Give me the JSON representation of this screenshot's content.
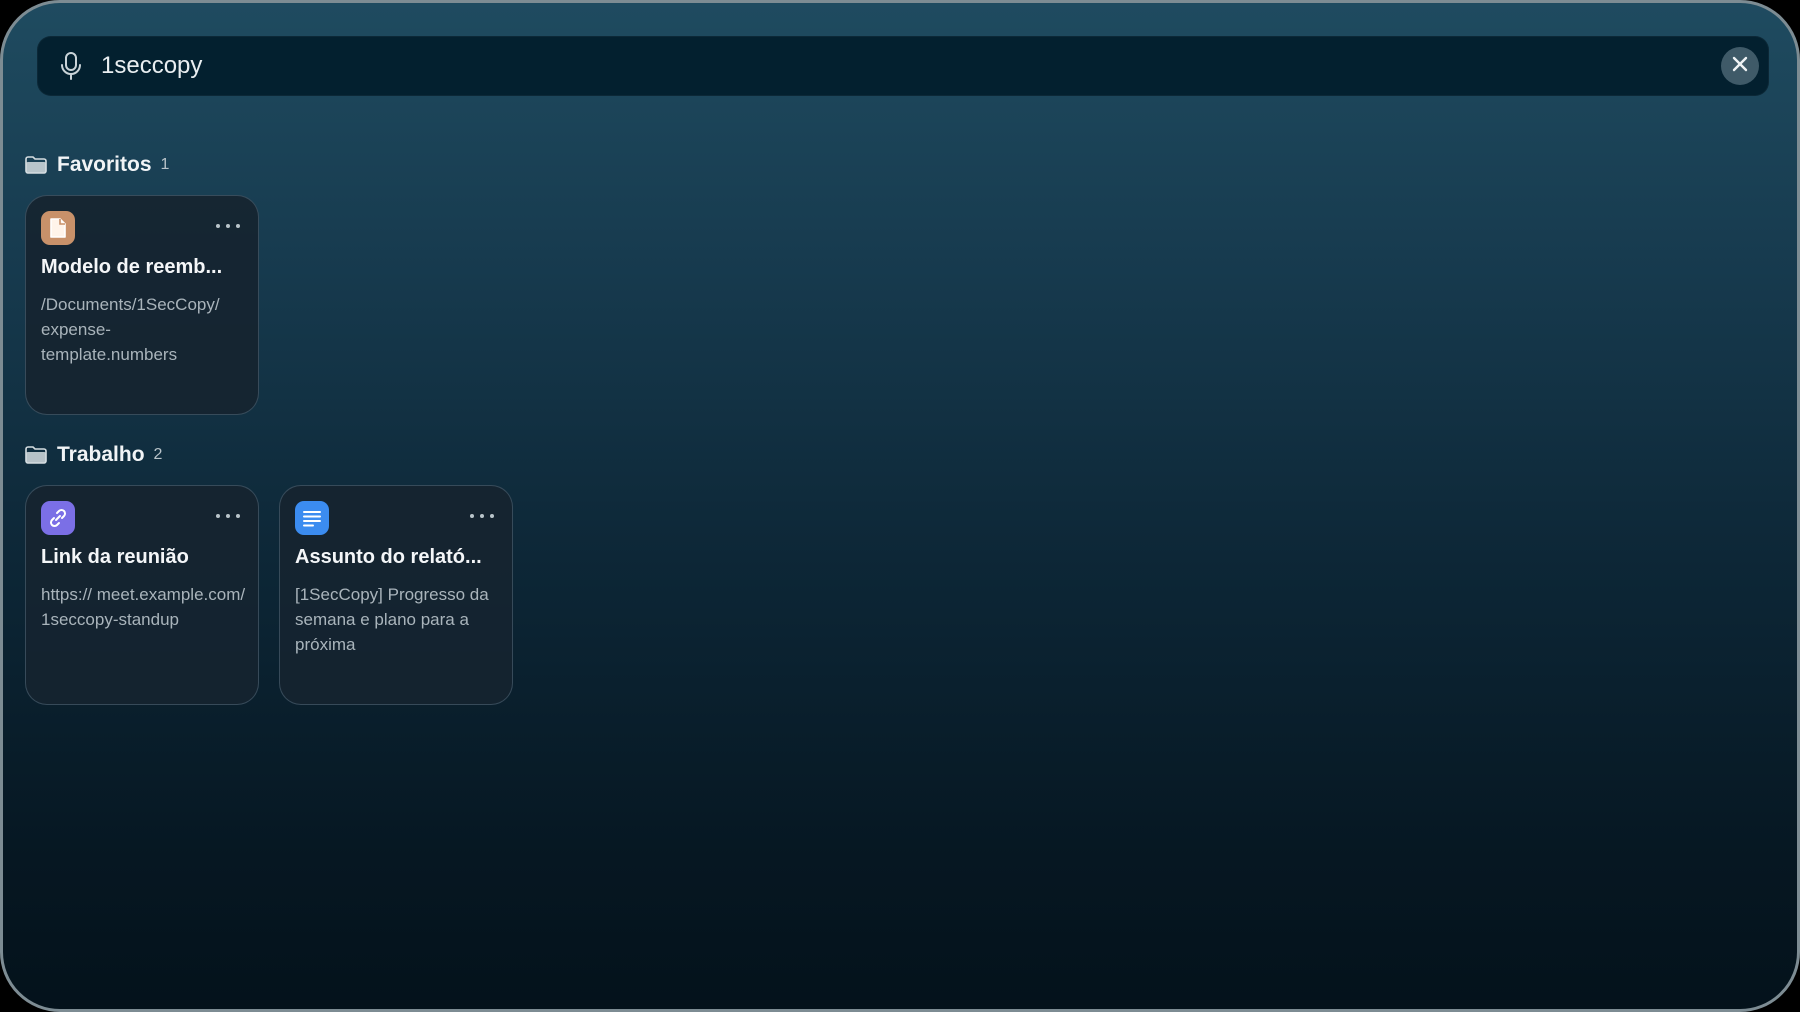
{
  "search": {
    "value": "1seccopy",
    "mic_icon": "microphone-icon",
    "clear_icon": "close-icon"
  },
  "sections": [
    {
      "title": "Favoritos",
      "count": "1",
      "items": [
        {
          "icon": "document-icon",
          "icon_color": "#c8916a",
          "title": "Modelo de reemb...",
          "description": "/Documents/1SecCopy/ expense- template.numbers"
        }
      ]
    },
    {
      "title": "Trabalho",
      "count": "2",
      "items": [
        {
          "icon": "link-icon",
          "icon_color": "#7b6fe6",
          "title": "Link da reunião",
          "description": "https:// meet.example.com/ 1seccopy-standup"
        },
        {
          "icon": "text-icon",
          "icon_color": "#3b8cf0",
          "title": "Assunto do relató...",
          "description": "[1SecCopy] Progresso da semana e plano para a próxima"
        }
      ]
    }
  ]
}
